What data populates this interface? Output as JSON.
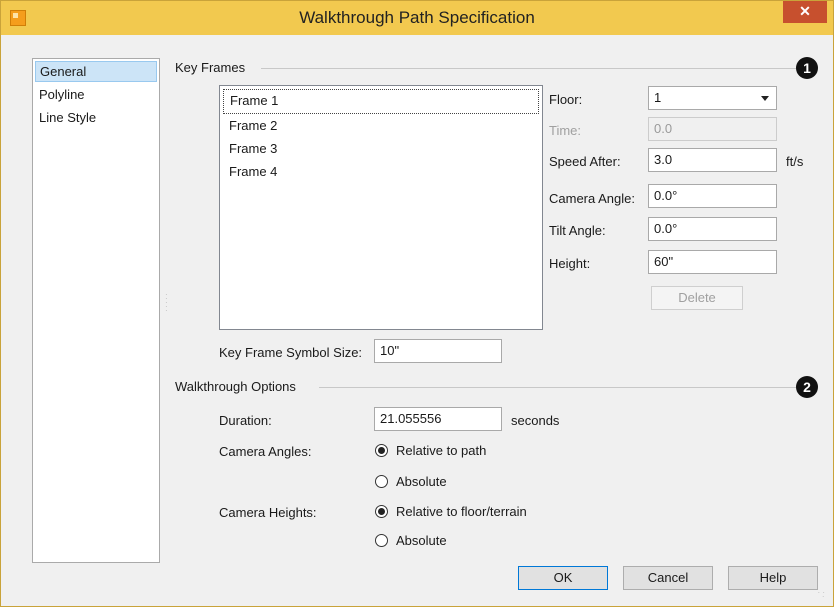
{
  "window": {
    "title": "Walkthrough Path Specification",
    "close_glyph": "✕",
    "icon": "app-icon"
  },
  "nav": {
    "items": [
      {
        "label": "General",
        "selected": true
      },
      {
        "label": "Polyline",
        "selected": false
      },
      {
        "label": "Line Style",
        "selected": false
      }
    ]
  },
  "key_frames": {
    "section_label": "Key Frames",
    "badge": "1",
    "frames": [
      "Frame 1",
      "Frame 2",
      "Frame 3",
      "Frame 4"
    ],
    "selected_frame": "Frame 1",
    "floor_label": "Floor:",
    "floor_value": "1",
    "time_label": "Time:",
    "time_value": "0.0",
    "speed_label": "Speed After:",
    "speed_value": "3.0",
    "speed_unit": "ft/s",
    "camera_angle_label": "Camera Angle:",
    "camera_angle_value": "0.0°",
    "tilt_angle_label": "Tilt Angle:",
    "tilt_angle_value": "0.0°",
    "height_label": "Height:",
    "height_value": "60\"",
    "delete_label": "Delete",
    "symbol_size_label": "Key Frame Symbol Size:",
    "symbol_size_value": "10\""
  },
  "walkthrough_options": {
    "section_label": "Walkthrough Options",
    "badge": "2",
    "duration_label": "Duration:",
    "duration_value": "21.055556",
    "duration_unit": "seconds",
    "camera_angles_label": "Camera Angles:",
    "camera_angles_options": [
      "Relative to path",
      "Absolute"
    ],
    "camera_angles_selected": "Relative to path",
    "camera_heights_label": "Camera Heights:",
    "camera_heights_options": [
      "Relative to floor/terrain",
      "Absolute"
    ],
    "camera_heights_selected": "Relative to floor/terrain"
  },
  "buttons": {
    "ok": "OK",
    "cancel": "Cancel",
    "help": "Help"
  },
  "colors": {
    "title_bar": "#f2c94f",
    "close_button": "#c7502e",
    "nav_selected": "#cce4f7"
  }
}
